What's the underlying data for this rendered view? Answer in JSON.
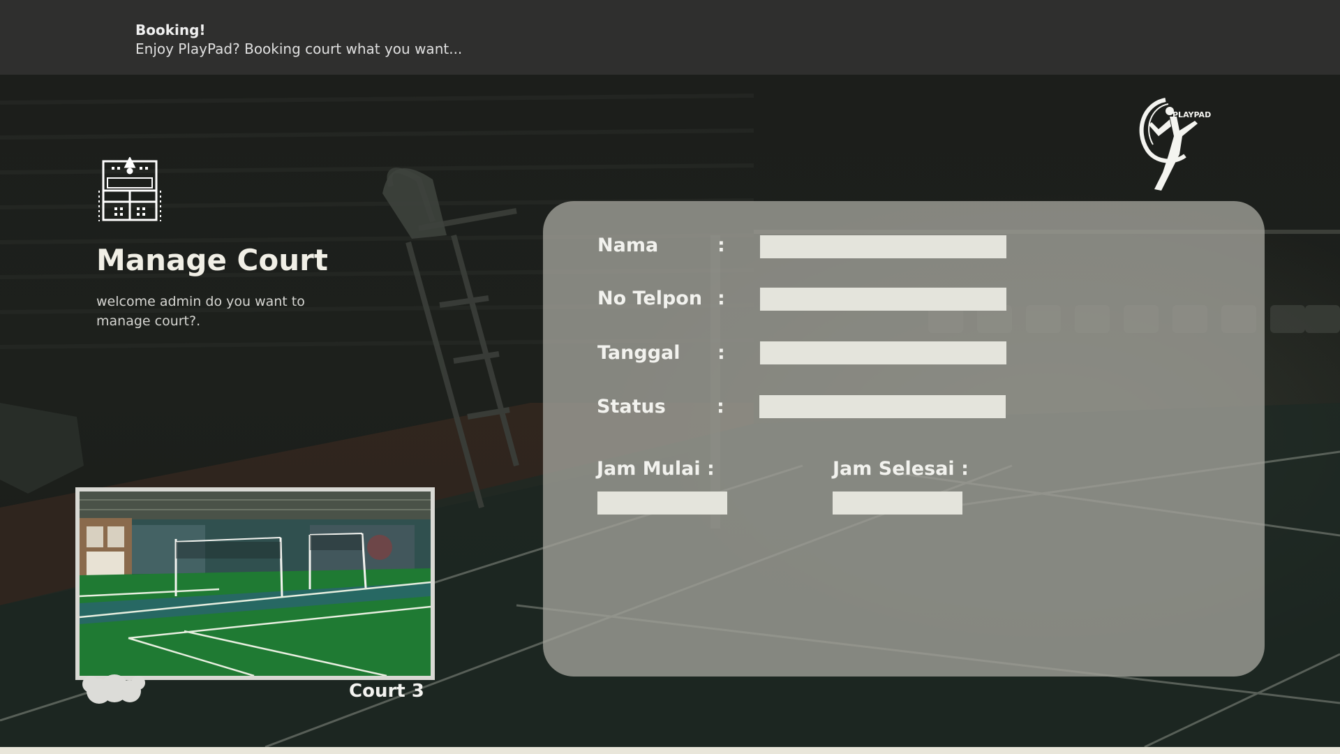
{
  "banner": {
    "title": "Booking!",
    "subtitle": "Enjoy PlayPad? Booking court what you want..."
  },
  "sidebar": {
    "icon": "scoreboard-court-icon",
    "title": "Manage Court",
    "description": "welcome admin do you want to manage court?.",
    "preview_caption": "Court 3"
  },
  "logo": {
    "icon": "playpad-badminton-player-logo",
    "text": "PLAYPAD"
  },
  "form": {
    "fields": [
      {
        "label": "Nama",
        "colon": ":",
        "value": "",
        "placeholder": ""
      },
      {
        "label": "No Telpon",
        "colon": ":",
        "value": "",
        "placeholder": ""
      },
      {
        "label": "Tanggal",
        "colon": ":",
        "value": "",
        "placeholder": ""
      },
      {
        "label": "Status",
        "colon": ":",
        "value": "",
        "placeholder": ""
      }
    ],
    "start_time": {
      "label": "Jam Mulai :",
      "value": ""
    },
    "end_time": {
      "label": "Jam Selesai :",
      "value": ""
    }
  },
  "colors": {
    "banner_bg": "#2f2f2e",
    "panel_bg": "#a0a098",
    "input_bg": "#e4e4dc",
    "court_green": "#1f7a33",
    "text_light": "#f1efe6"
  }
}
